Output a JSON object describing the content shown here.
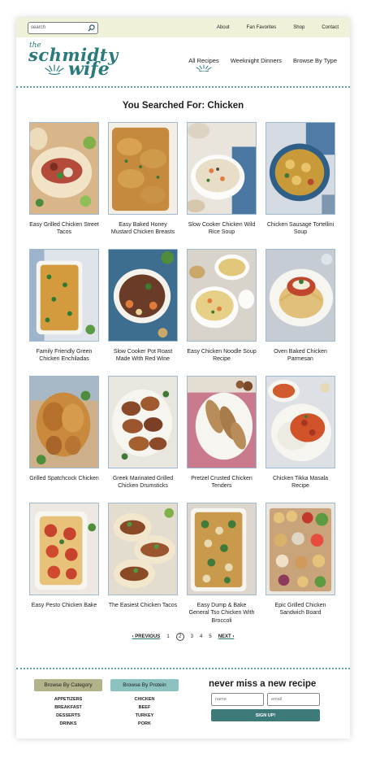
{
  "search": {
    "placeholder": "search"
  },
  "top_nav": [
    "About",
    "Fan Favorites",
    "Shop",
    "Contact"
  ],
  "logo": {
    "the": "the",
    "name1": "schmidty",
    "name2": "wife"
  },
  "main_nav": [
    "All Recipes",
    "Weeknight Dinners",
    "Browse By Type"
  ],
  "page_title": "You Searched For: Chicken",
  "recipes": [
    "Easy Grilled Chicken Street Tacos",
    "Easy Baked Honey Mustard Chicken Breasts",
    "Slow Cooker Chicken Wild Rice Soup",
    "Chicken Sausage Tortellini Soup",
    "Family Friendly Green Chicken Enchiladas",
    "Slow Cooker Pot Roast Made With Red Wine",
    "Easy Chicken Noodle Soup Recipe",
    "Oven Baked Chicken Parmesan",
    "Grilled Spatchcock Chicken",
    "Greek Marinated Grilled Chicken Drumsticks",
    "Pretzel Crusted Chicken Tenders",
    "Chicken Tikka Masala Recipe",
    "Easy Pesto Chicken Bake",
    "The Easiest Chicken Tacos",
    "Easy Dump & Bake General Tso Chicken With Broccoli",
    "Epic Grilled Chicken Sandwich Board"
  ],
  "pagination": {
    "prev": "‹ PREVIOUS",
    "pages": [
      "1",
      "2",
      "3",
      "4",
      "5"
    ],
    "current": "2",
    "next": "NEXT ›"
  },
  "footer": {
    "category_btn": "Browse By Category",
    "category_items": [
      "APPETIZERS",
      "BREAKFAST",
      "DESSERTS",
      "DRINKS"
    ],
    "protein_btn": "Browse By Protein",
    "protein_items": [
      "CHICKEN",
      "BEEF",
      "TURKEY",
      "PORK"
    ],
    "signup_title": "never miss a new recipe",
    "name_placeholder": "name",
    "email_placeholder": "email",
    "signup_btn": "SIGN UP!"
  },
  "colors": {
    "accent": "#2a7a7c",
    "topbar": "#eff1d9",
    "category": "#b2b38a",
    "protein": "#8cc2c0",
    "signup": "#3f7a7a"
  }
}
